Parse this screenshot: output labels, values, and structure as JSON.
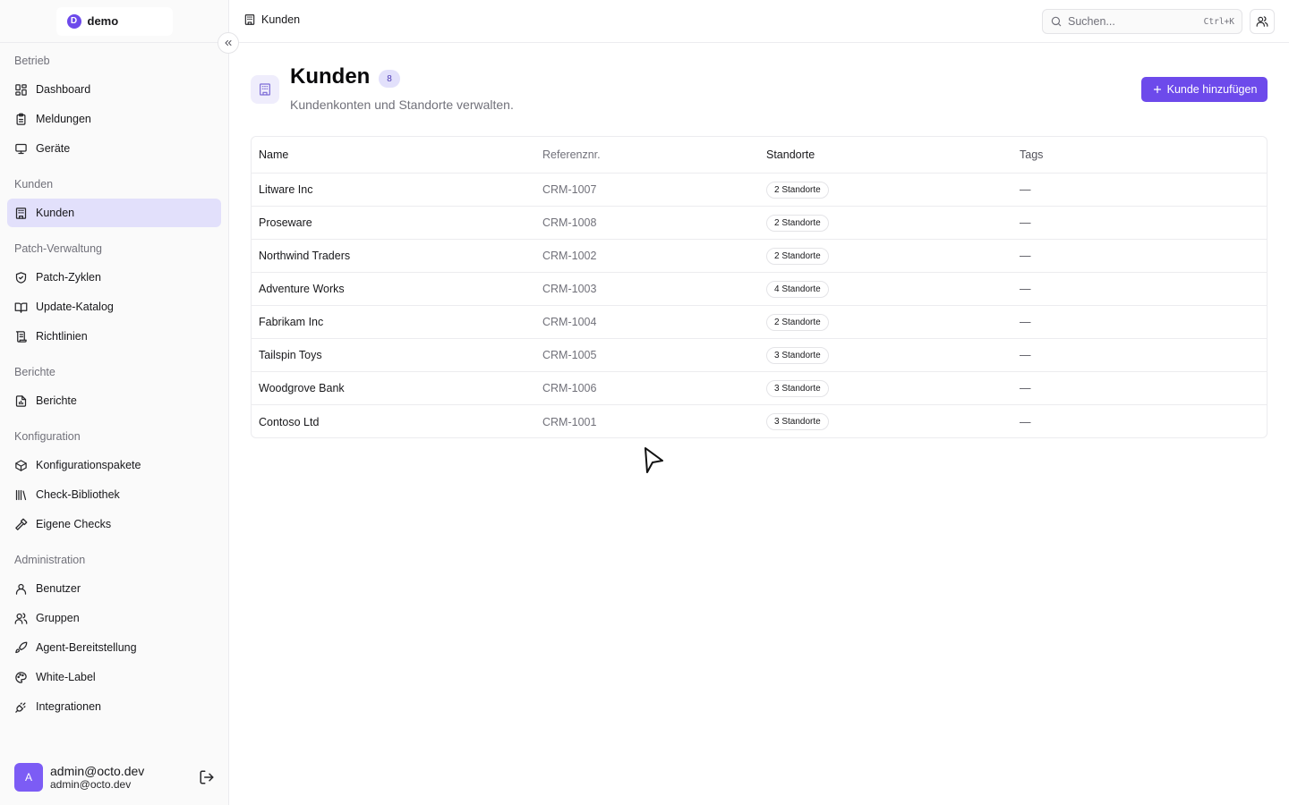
{
  "org": {
    "logo_letter": "D",
    "name": "demo"
  },
  "sidebar": {
    "sections": [
      {
        "label": "Betrieb",
        "items": [
          {
            "label": "Dashboard",
            "icon": "dashboard-icon"
          },
          {
            "label": "Meldungen",
            "icon": "clipboard-icon"
          },
          {
            "label": "Geräte",
            "icon": "monitor-icon"
          }
        ]
      },
      {
        "label": "Kunden",
        "items": [
          {
            "label": "Kunden",
            "icon": "building-icon",
            "active": true
          }
        ]
      },
      {
        "label": "Patch-Verwaltung",
        "items": [
          {
            "label": "Patch-Zyklen",
            "icon": "shield-check-icon"
          },
          {
            "label": "Update-Katalog",
            "icon": "book-open-icon"
          },
          {
            "label": "Richtlinien",
            "icon": "scroll-icon"
          }
        ]
      },
      {
        "label": "Berichte",
        "items": [
          {
            "label": "Berichte",
            "icon": "file-report-icon"
          }
        ]
      },
      {
        "label": "Konfiguration",
        "items": [
          {
            "label": "Konfigurationspakete",
            "icon": "package-icon"
          },
          {
            "label": "Check-Bibliothek",
            "icon": "library-icon"
          },
          {
            "label": "Eigene Checks",
            "icon": "hammer-icon"
          }
        ]
      },
      {
        "label": "Administration",
        "items": [
          {
            "label": "Benutzer",
            "icon": "user-icon"
          },
          {
            "label": "Gruppen",
            "icon": "users-icon"
          },
          {
            "label": "Agent-Bereitstellung",
            "icon": "rocket-icon"
          },
          {
            "label": "White-Label",
            "icon": "palette-icon"
          },
          {
            "label": "Integrationen",
            "icon": "plug-icon"
          }
        ]
      }
    ]
  },
  "user": {
    "initial": "A",
    "name": "admin@octo.dev",
    "email": "admin@octo.dev"
  },
  "topbar": {
    "breadcrumb": "Kunden",
    "search_placeholder": "Suchen...",
    "search_shortcut": "Ctrl+K"
  },
  "page": {
    "title": "Kunden",
    "count": "8",
    "subtitle": "Kundenkonten und Standorte verwalten.",
    "add_button": "Kunde hinzufügen"
  },
  "table": {
    "headers": [
      "Name",
      "Referenznr.",
      "Standorte",
      "Tags"
    ],
    "rows": [
      {
        "name": "Litware Inc",
        "ref": "CRM-1007",
        "sites": "2 Standorte",
        "tags": "—"
      },
      {
        "name": "Proseware",
        "ref": "CRM-1008",
        "sites": "2 Standorte",
        "tags": "—"
      },
      {
        "name": "Northwind Traders",
        "ref": "CRM-1002",
        "sites": "2 Standorte",
        "tags": "—"
      },
      {
        "name": "Adventure Works",
        "ref": "CRM-1003",
        "sites": "4 Standorte",
        "tags": "—"
      },
      {
        "name": "Fabrikam Inc",
        "ref": "CRM-1004",
        "sites": "2 Standorte",
        "tags": "—"
      },
      {
        "name": "Tailspin Toys",
        "ref": "CRM-1005",
        "sites": "3 Standorte",
        "tags": "—"
      },
      {
        "name": "Woodgrove Bank",
        "ref": "CRM-1006",
        "sites": "3 Standorte",
        "tags": "—"
      },
      {
        "name": "Contoso Ltd",
        "ref": "CRM-1001",
        "sites": "3 Standorte",
        "tags": "—"
      }
    ]
  },
  "colors": {
    "accent": "#6d4aeb",
    "active_bg": "#e2e0fb"
  }
}
